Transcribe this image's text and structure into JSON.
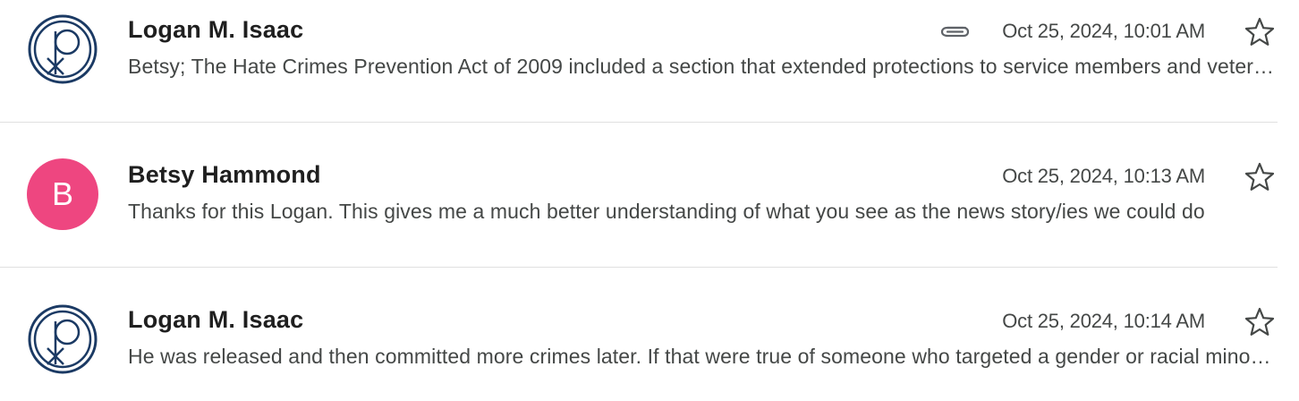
{
  "messages": [
    {
      "sender": "Logan M. Isaac",
      "avatar_type": "logo",
      "has_attachment": true,
      "date": "Oct 25, 2024, 10:01 AM",
      "snippet": "Betsy; The Hate Crimes Prevention Act of 2009 included a section that extended protections to service members and veterans who have been targeted",
      "starred": false
    },
    {
      "sender": "Betsy Hammond",
      "avatar_type": "letter",
      "avatar_letter": "B",
      "avatar_color": "#ee4680",
      "has_attachment": false,
      "date": "Oct 25, 2024, 10:13 AM",
      "snippet": "Thanks for this Logan. This gives me a much better understanding of what you see as the news story/ies we could do",
      "starred": false
    },
    {
      "sender": "Logan M. Isaac",
      "avatar_type": "logo",
      "has_attachment": false,
      "date": "Oct 25, 2024, 10:14 AM",
      "snippet": "He was released and then committed more crimes later. If that were true of someone who targeted a gender or racial minority",
      "starred": false
    }
  ],
  "icons": {
    "attachment": "paperclip-icon",
    "star": "star-outline-icon",
    "logo": "chi-rho-logo-icon"
  },
  "colors": {
    "logo_navy": "#1b3a64",
    "text_primary": "#1f1f1f",
    "text_secondary": "#444746",
    "divider": "#e0e0e0"
  }
}
